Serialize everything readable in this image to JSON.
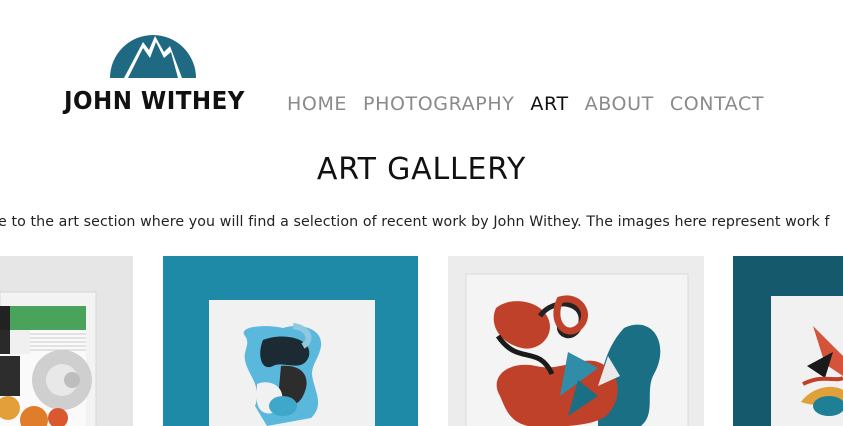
{
  "header": {
    "logo_text": "JOHN WITHEY",
    "logo_icon": "mountain-circle-icon",
    "brand_color": "#1f6a82"
  },
  "nav": {
    "items": [
      {
        "label": "HOME",
        "active": false
      },
      {
        "label": "PHOTOGRAPHY",
        "active": false
      },
      {
        "label": "ART",
        "active": true
      },
      {
        "label": "ABOUT",
        "active": false
      },
      {
        "label": "CONTACT",
        "active": false
      }
    ]
  },
  "main": {
    "title": "ART GALLERY",
    "intro": "e to the art section where you will find a selection of recent work by John Withey. The images here represent work f"
  },
  "gallery": {
    "items": [
      {
        "name": "artwork-geometric",
        "background": "#e6e6e6"
      },
      {
        "name": "artwork-blue-abstract",
        "background": "#1e8aa8"
      },
      {
        "name": "artwork-red-abstract",
        "background": "#ececec"
      },
      {
        "name": "artwork-teal-abstract",
        "background": "#145a6c"
      }
    ]
  }
}
